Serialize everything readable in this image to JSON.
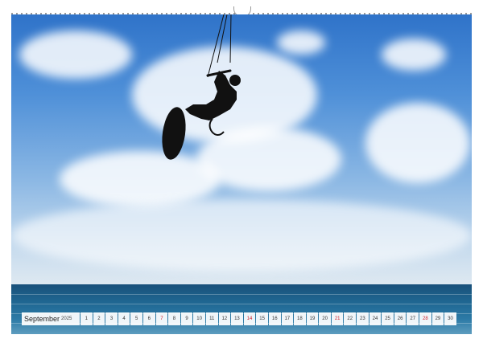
{
  "calendar": {
    "month": "September",
    "year": "2025",
    "days": [
      {
        "n": "1",
        "sun": false
      },
      {
        "n": "2",
        "sun": false
      },
      {
        "n": "3",
        "sun": false
      },
      {
        "n": "4",
        "sun": false
      },
      {
        "n": "5",
        "sun": false
      },
      {
        "n": "6",
        "sun": false
      },
      {
        "n": "7",
        "sun": true
      },
      {
        "n": "8",
        "sun": false
      },
      {
        "n": "9",
        "sun": false
      },
      {
        "n": "10",
        "sun": false
      },
      {
        "n": "11",
        "sun": false
      },
      {
        "n": "12",
        "sun": false
      },
      {
        "n": "13",
        "sun": false
      },
      {
        "n": "14",
        "sun": true
      },
      {
        "n": "15",
        "sun": false
      },
      {
        "n": "16",
        "sun": false
      },
      {
        "n": "17",
        "sun": false
      },
      {
        "n": "18",
        "sun": false
      },
      {
        "n": "19",
        "sun": false
      },
      {
        "n": "20",
        "sun": false
      },
      {
        "n": "21",
        "sun": true
      },
      {
        "n": "22",
        "sun": false
      },
      {
        "n": "23",
        "sun": false
      },
      {
        "n": "24",
        "sun": false
      },
      {
        "n": "25",
        "sun": false
      },
      {
        "n": "26",
        "sun": false
      },
      {
        "n": "27",
        "sun": false
      },
      {
        "n": "28",
        "sun": true
      },
      {
        "n": "29",
        "sun": false
      },
      {
        "n": "30",
        "sun": false
      }
    ]
  },
  "photo": {
    "subject": "kitesurfer-silhouette",
    "sky_top_color": "#2f73c9",
    "sea_color": "#1f6691"
  },
  "colors": {
    "sunday": "#d0202a"
  }
}
